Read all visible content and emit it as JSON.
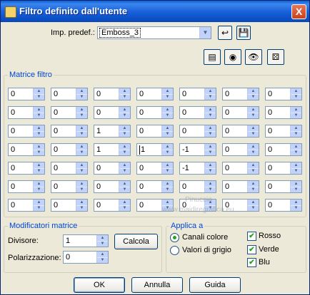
{
  "window": {
    "title": "Filtro definito dall'utente",
    "close_glyph": "X"
  },
  "preset": {
    "label": "Imp. predef.:",
    "value": "Emboss_3"
  },
  "matrix": {
    "label": "Matrice filtro",
    "rows": [
      [
        "0",
        "0",
        "0",
        "0",
        "0",
        "0",
        "0"
      ],
      [
        "0",
        "0",
        "0",
        "0",
        "0",
        "0",
        "0"
      ],
      [
        "0",
        "0",
        "1",
        "0",
        "0",
        "0",
        "0"
      ],
      [
        "0",
        "0",
        "1",
        "1",
        "-1",
        "0",
        "0"
      ],
      [
        "0",
        "0",
        "0",
        "0",
        "-1",
        "0",
        "0"
      ],
      [
        "0",
        "0",
        "0",
        "0",
        "0",
        "0",
        "0"
      ],
      [
        "0",
        "0",
        "0",
        "0",
        "0",
        "0",
        "0"
      ]
    ]
  },
  "watermark": {
    "line1": "Pinuccia",
    "line2": "www.maidiregrafica.eu"
  },
  "modifiers": {
    "label": "Modificatori matrice",
    "divisor_label": "Divisore:",
    "divisor_value": "1",
    "calc_label": "Calcola",
    "bias_label": "Polarizzazione:",
    "bias_value": "0"
  },
  "apply": {
    "label": "Applica a",
    "color_channels": "Canali colore",
    "grey_values": "Valori di grigio",
    "red": "Rosso",
    "green": "Verde",
    "blue": "Blu"
  },
  "buttons": {
    "ok": "OK",
    "cancel": "Annulla",
    "help": "Guida"
  },
  "icons": [
    "reset-arrow-icon",
    "save-disk-icon",
    "toggle-preview-icon",
    "proof-eye-icon",
    "eye-icon",
    "randomize-dice-icon"
  ]
}
